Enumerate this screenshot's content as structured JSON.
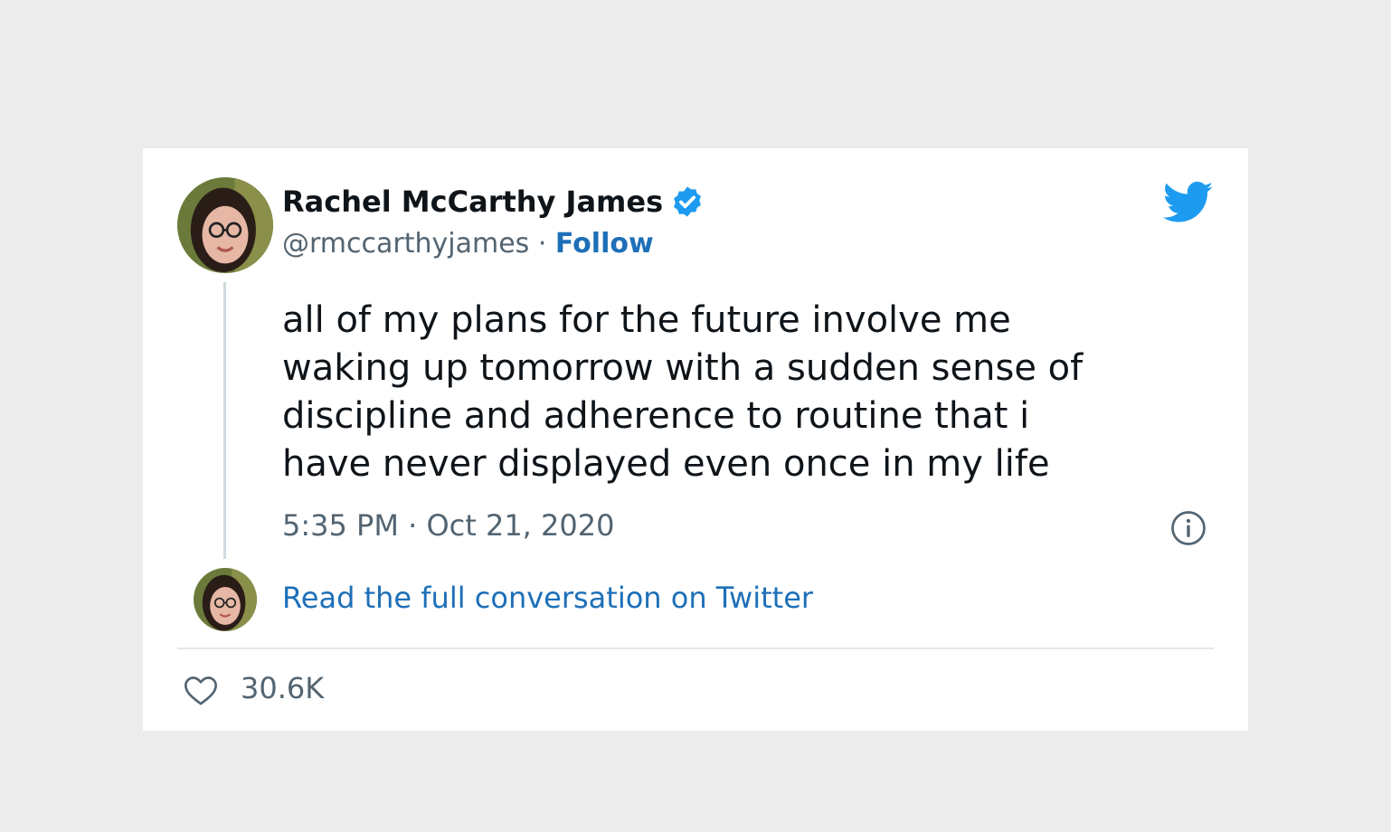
{
  "tweet": {
    "author_name": "Rachel McCarthy James",
    "handle": "@rmccarthyjames",
    "separator": " · ",
    "follow_label": "Follow",
    "text_lines": [
      "all of my plans for the future involve me",
      "waking up tomorrow with a sudden sense of",
      "discipline and adherence to routine that i",
      "have never displayed even once in my life"
    ],
    "timestamp": "5:35 PM · Oct 21, 2020",
    "read_full_label": "Read the full conversation on Twitter",
    "like_count": "30.6K"
  },
  "icons": {
    "verified": "verified-badge-icon",
    "bird": "twitter-bird-icon",
    "info": "info-icon",
    "like": "heart-icon"
  },
  "colors": {
    "background": "#ececec",
    "card": "#ffffff",
    "text": "#0f1419",
    "muted": "#536471",
    "link": "#1d6fb8",
    "twitter_blue": "#1d9bf0"
  }
}
